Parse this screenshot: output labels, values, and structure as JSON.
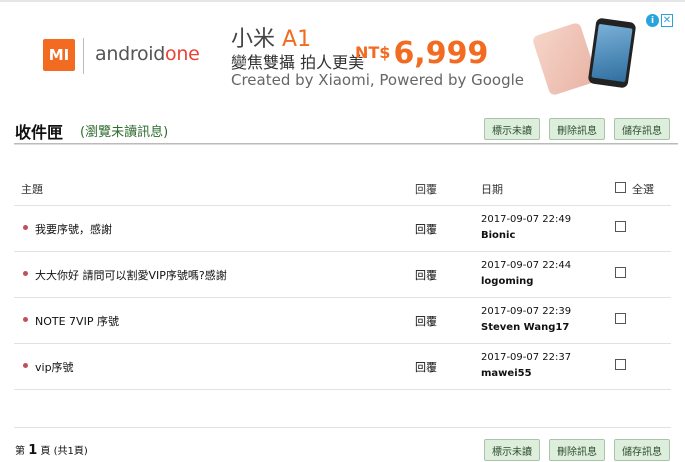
{
  "ad": {
    "brand_logo": "MI",
    "partner": "android",
    "partner_suffix": "one",
    "headline_main": "小米",
    "headline_model": "A1",
    "tagline": "變焦雙攝 拍人更美",
    "price_currency": "NT$",
    "price": "6,999",
    "credit": "Created by Xiaomi, Powered by Google",
    "choices_icon": "info-icon",
    "close_icon": "close-icon"
  },
  "header": {
    "title": "收件匣",
    "link": "(瀏覽未讀訊息)"
  },
  "toolbar": {
    "mark_unread": "標示未讀",
    "delete": "刪除訊息",
    "save": "儲存訊息"
  },
  "table": {
    "columns": {
      "subject": "主題",
      "reply": "回覆",
      "date": "日期",
      "select_all": "全選"
    },
    "rows": [
      {
        "subject": "我要序號，感謝",
        "reply": "回覆",
        "date": "2017-09-07 22:49",
        "sender": "Bionic"
      },
      {
        "subject": "大大你好 請問可以割愛VIP序號嗎?感謝",
        "reply": "回覆",
        "date": "2017-09-07 22:44",
        "sender": "logoming"
      },
      {
        "subject": "NOTE 7VIP 序號",
        "reply": "回覆",
        "date": "2017-09-07 22:39",
        "sender": "Steven Wang17"
      },
      {
        "subject": "vip序號",
        "reply": "回覆",
        "date": "2017-09-07 22:37",
        "sender": "mawei55"
      }
    ]
  },
  "pager": {
    "prefix": "第",
    "page": "1",
    "suffix": "頁 (共1頁)"
  },
  "colors": {
    "bullet": "#c0505a",
    "button_bg": "#ddeedd",
    "link": "#2e6b2e",
    "brand": "#f26b21"
  }
}
